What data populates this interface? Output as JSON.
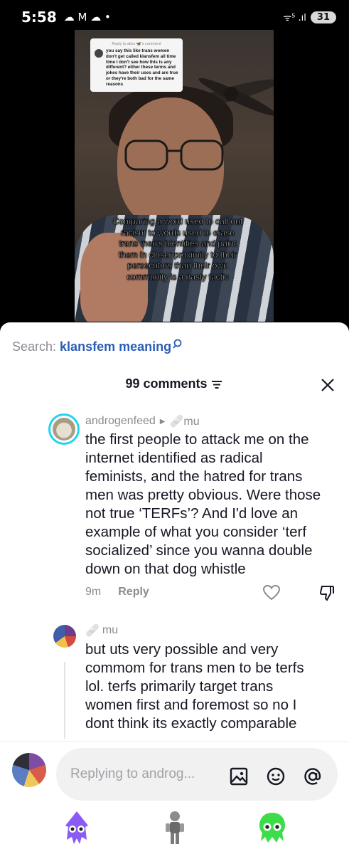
{
  "status_bar": {
    "time": "5:58",
    "notif_icons": "☁ M ☁ •",
    "signal": "ᯤ⁵ .ıl",
    "battery": "31"
  },
  "video": {
    "reply_to_label": "Reply to alice 🦋's comment",
    "reply_text": "you say this like trans women don't get called klansfem all time time I don't see how this is any different? either these terms and jokes have their uses and are true or they're both bad for the same reasons",
    "caption": "Comparing a word used to call out racism to words used to erase trans men's identities and paint them in closer proximity to their persecutors than their own community is a nasty tactic"
  },
  "search": {
    "label": "Search:",
    "term": "klansfem meaning"
  },
  "comments_header": {
    "count_label": "99 comments"
  },
  "comments": [
    {
      "username": "androgenfeed",
      "reply_target": "mu",
      "text_lines": [
        "the first people to attack me on the",
        "internet identified as radical",
        "feminists, and the hatred for trans",
        "men was pretty obvious. Were those",
        "not true ‘TERFs’? And I'd love an",
        "example of what you consider ‘terf",
        "socialized’ since you wanna double",
        "down on that dog whistle"
      ],
      "time": "9m",
      "reply_label": "Reply"
    },
    {
      "username": "mu",
      "text_lines": [
        "but uts very possible and very",
        "commom for trans men to be terfs",
        "lol. terfs primarily target trans",
        "women first and foremost so no I",
        "dont think its exactly comparable"
      ]
    }
  ],
  "input": {
    "placeholder": "Replying to androg..."
  },
  "icons": {
    "bandage": "🩹",
    "triangle": "▶"
  },
  "colors": {
    "search_term": "#2b5db5",
    "avatar_ring": "#20d5ec",
    "nav_purple": "#8a5cf5",
    "nav_green": "#3ddc4a"
  }
}
